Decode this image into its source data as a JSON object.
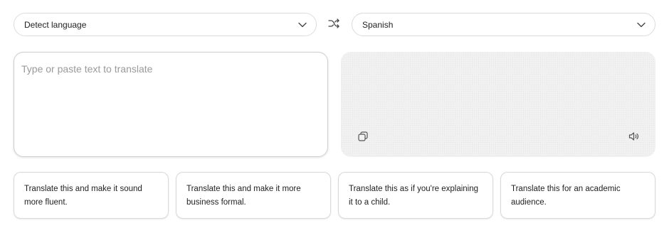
{
  "source_language": {
    "selected": "Detect language",
    "icon": "chevron-down-icon"
  },
  "target_language": {
    "selected": "Spanish",
    "icon": "chevron-down-icon"
  },
  "swap": {
    "icon": "shuffle-icon"
  },
  "source_input": {
    "value": "",
    "placeholder": "Type or paste text to translate"
  },
  "output": {
    "text": "",
    "copy_icon": "copy-icon",
    "speak_icon": "speaker-icon"
  },
  "suggestions": [
    {
      "label": "Translate this and make it sound more fluent."
    },
    {
      "label": "Translate this and make it more business formal."
    },
    {
      "label": "Translate this as if you're explaining it to a child."
    },
    {
      "label": "Translate this for an academic audience."
    }
  ],
  "colors": {
    "border": "#dcdcdc",
    "output_background": "#f1f1f1",
    "placeholder": "#9a9a9a",
    "text": "#222222"
  }
}
